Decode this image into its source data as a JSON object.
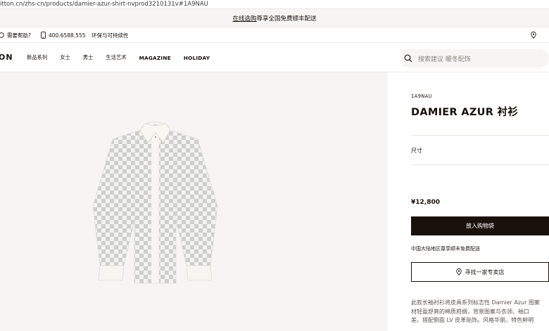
{
  "browser": {
    "url": "itton.cn/zhs-cn/products/damier-azur-shirt-nvprod3210131v#1A9NAU"
  },
  "promo": {
    "link": "在线选购",
    "text": "尊享全国免费顺丰配送"
  },
  "utility": {
    "help": "需要帮助?",
    "phone": "400.6588.555",
    "sustainability": "环保与可持续性"
  },
  "nav": {
    "logo": "ON",
    "items": [
      "新品系列",
      "女士",
      "男士",
      "生活艺术",
      "MAGAZINE",
      "HOLIDAY"
    ],
    "search_placeholder": "搜索建议  暖冬配饰"
  },
  "product": {
    "sku": "1A9NAU",
    "title": "DAMIER AZUR 衬衫",
    "size_label": "尺寸",
    "price": "¥12,800",
    "add_to_bag": "放入购物袋",
    "shipping_note": "中国大陆地区尊享顺丰免费配送",
    "find_store": "寻找一家专卖店",
    "description_lines": [
      "此款长袖衬衫将皮具系列标志性 Damier Azur 图案",
      "材轻盈舒爽的棉质府绸，背景图案与衣领、袖口",
      "差。搭配侧面 LV 皮革贴饰。风格华丽，特色鲜明"
    ]
  },
  "colors": {
    "brand_dark": "#19110b",
    "panel_bg": "#f6f5f3",
    "check_grey": "#cfcfcf"
  },
  "icons": [
    "phone-icon",
    "help-icon",
    "location-pin-icon",
    "search-icon",
    "store-pin-icon"
  ]
}
